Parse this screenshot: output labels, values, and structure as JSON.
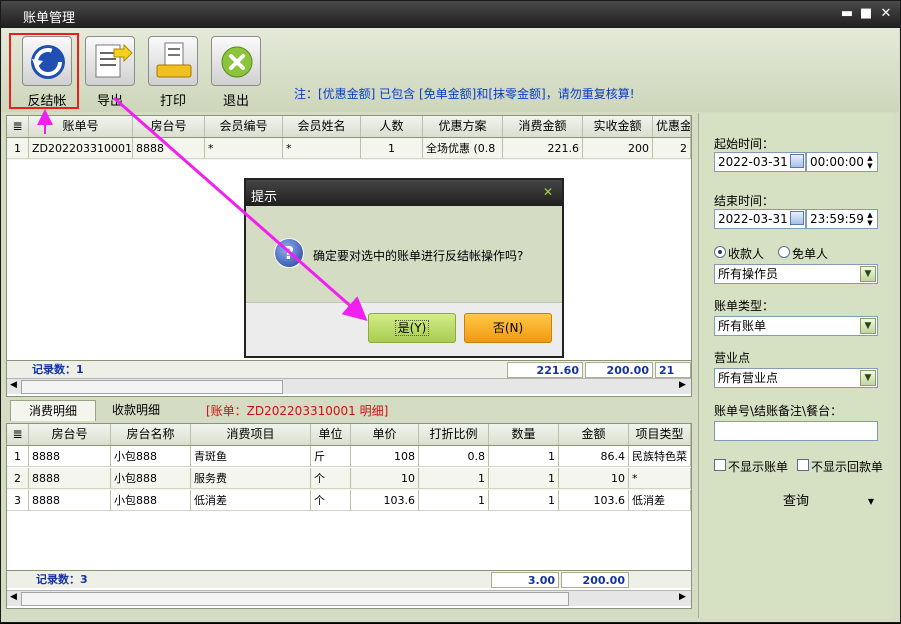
{
  "window": {
    "title": "账单管理",
    "min": "▬",
    "max": "■",
    "close": "✕"
  },
  "toolbar": {
    "buttons": [
      {
        "label": "反结帐",
        "icon": "undo-icon"
      },
      {
        "label": "导出",
        "icon": "export-icon"
      },
      {
        "label": "打印",
        "icon": "print-icon"
      },
      {
        "label": "退出",
        "icon": "exit-icon"
      }
    ],
    "note": "注：[优惠金额] 已包含 [免单金额]和[抹零金额]，请勿重复核算!"
  },
  "bills": {
    "columns": [
      "账单号",
      "房台号",
      "会员编号",
      "会员姓名",
      "人数",
      "优惠方案",
      "消费金额",
      "实收金额",
      "优惠金"
    ],
    "rows": [
      {
        "num": "1",
        "bill": "ZD202203310001",
        "room": "8888",
        "member_no": "*",
        "member_name": "*",
        "people": "1",
        "plan": "全场优惠 (0.8",
        "consume": "221.6",
        "received": "200",
        "discount": "2"
      }
    ],
    "record_count": "记录数：1",
    "sum_consume": "221.60",
    "sum_received": "200.00",
    "sum_discount": "21"
  },
  "detail_tabs": {
    "consume": "消费明细",
    "receipt": "收款明细",
    "bill_label": "[账单：ZD202203310001 明细]"
  },
  "details": {
    "columns": [
      "房台号",
      "房台名称",
      "消费项目",
      "单位",
      "单价",
      "打折比例",
      "数量",
      "金额",
      "项目类型"
    ],
    "rows": [
      {
        "num": "1",
        "room": "8888",
        "room_name": "小包888",
        "item": "青斑鱼",
        "unit": "斤",
        "price": "108",
        "ratio": "0.8",
        "qty": "1",
        "amount": "86.4",
        "type": "民族特色菜"
      },
      {
        "num": "2",
        "room": "8888",
        "room_name": "小包888",
        "item": "服务费",
        "unit": "个",
        "price": "10",
        "ratio": "1",
        "qty": "1",
        "amount": "10",
        "type": "*"
      },
      {
        "num": "3",
        "room": "8888",
        "room_name": "小包888",
        "item": "低消差",
        "unit": "个",
        "price": "103.6",
        "ratio": "1",
        "qty": "1",
        "amount": "103.6",
        "type": "低消差"
      }
    ],
    "record_count": "记录数：3",
    "sum_qty": "3.00",
    "sum_amount": "200.00"
  },
  "sidebar": {
    "start_label": "起始时间：",
    "start_date": "2022-03-31",
    "start_time": "00:00:00",
    "end_label": "结束时间：",
    "end_date": "2022-03-31",
    "end_time": "23:59:59",
    "radio_cashier": "收款人",
    "radio_free": "免单人",
    "operator": "所有操作员",
    "type_label": "账单类型：",
    "type_value": "所有账单",
    "point_label": "营业点",
    "point_value": "所有营业点",
    "search_label": "账单号\\结账备注\\餐台：",
    "search_value": "",
    "hide_bill": "不显示账单",
    "hide_refund": "不显示回款单",
    "query": "查询"
  },
  "dialog": {
    "title": "提示",
    "close": "✕",
    "message": "确定要对选中的账单进行反结帐操作吗?",
    "yes": "是(Y)",
    "no": "否(N)"
  }
}
